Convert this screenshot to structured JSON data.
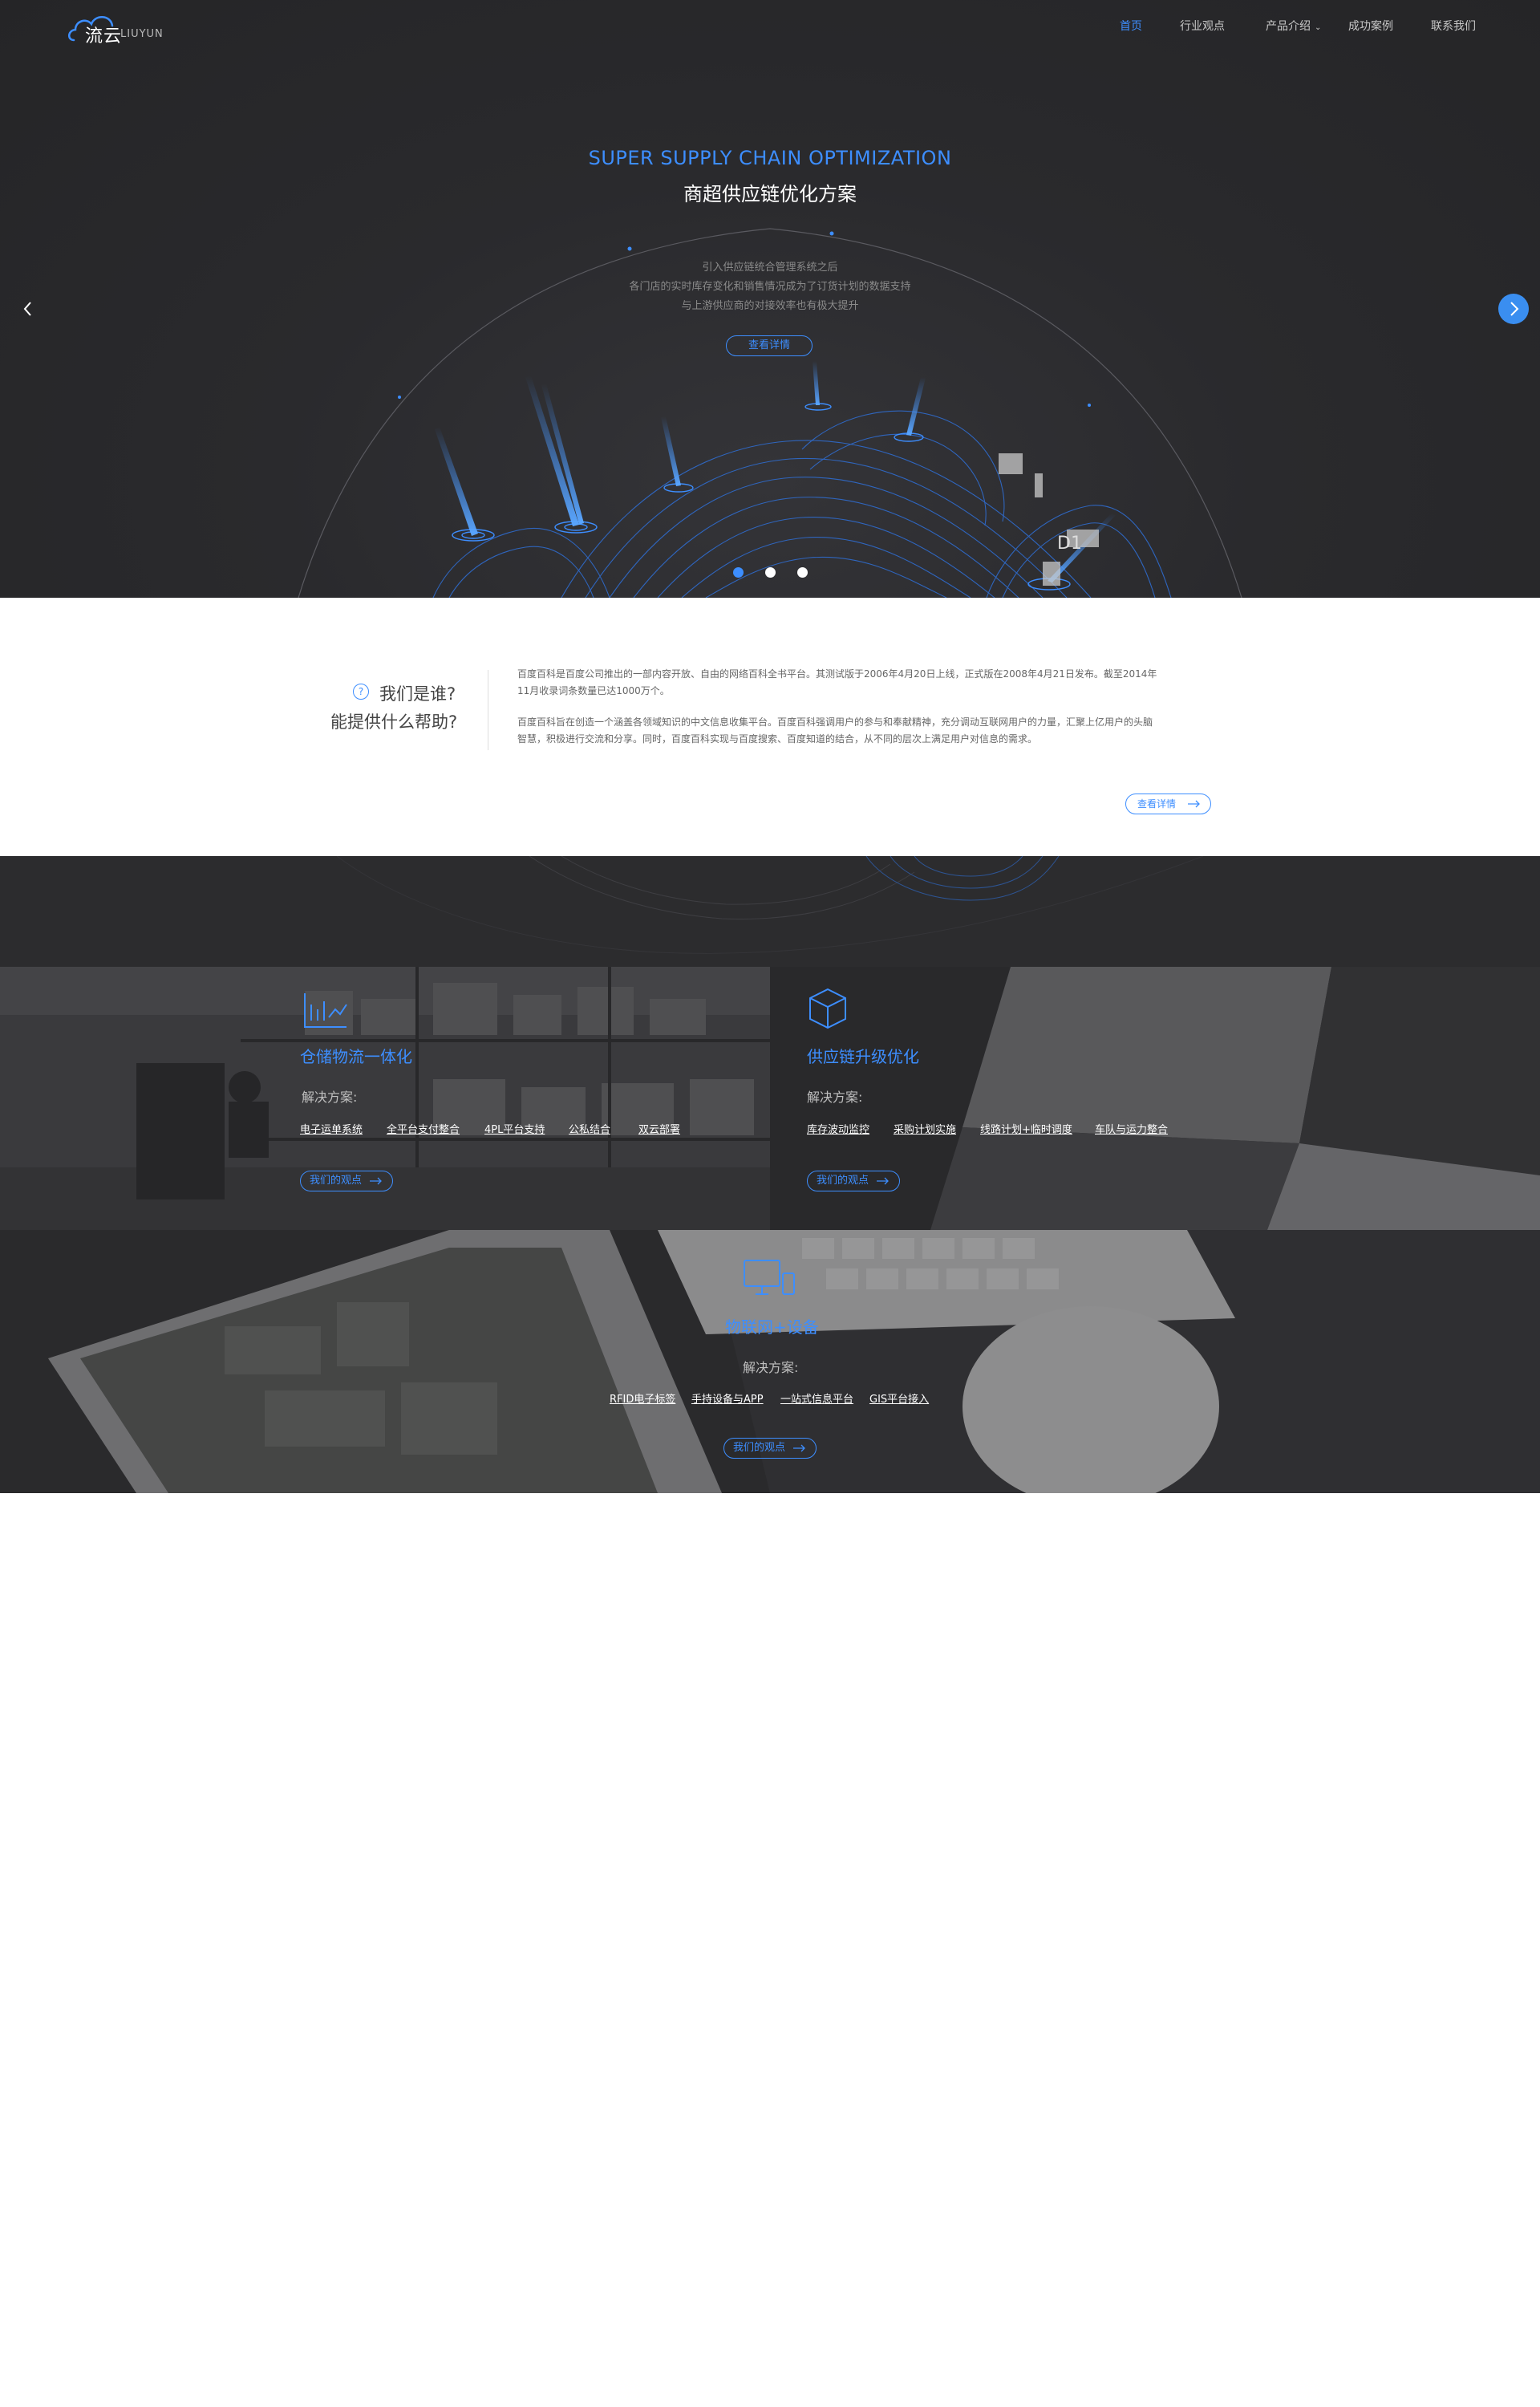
{
  "brand": {
    "name_cn": "流云",
    "name_en": "LIUYUN"
  },
  "nav": {
    "items": [
      {
        "label": "首页"
      },
      {
        "label": "行业观点"
      },
      {
        "label": "产品介绍"
      },
      {
        "label": "成功案例"
      },
      {
        "label": "联系我们"
      }
    ]
  },
  "hero": {
    "title_en": "SUPER SUPPLY CHAIN OPTIMIZATION",
    "title_cn": "商超供应链优化方案",
    "desc": [
      "引入供应链统合管理系统之后",
      "各门店的实时库存变化和销售情况成为了订货计划的数据支持",
      "与上游供应商的对接效率也有极大提升"
    ],
    "button": "查看详情",
    "mark": "D1",
    "slides": 3,
    "active_slide": 1
  },
  "about": {
    "title_line1": "我们是谁?",
    "title_line2": "能提供什么帮助?",
    "para1_line1": "百度百科是百度公司推出的一部内容开放、自由的网络百科全书平台。其测试版于2006年4月20日上线，正式版在2008年4月21日发布。截至2014年",
    "para1_line2": "11月收录词条数量已达1000万个。",
    "para2_line1": "百度百科旨在创造一个涵盖各领域知识的中文信息收集平台。百度百科强调用户的参与和奉献精神，充分调动互联网用户的力量，汇聚上亿用户的头脑",
    "para2_line2": "智慧，积极进行交流和分享。同时，百度百科实现与百度搜索、百度知道的结合，从不同的层次上满足用户对信息的需求。",
    "button": "查看详情"
  },
  "solutions": {
    "subtitle": "解决方案:",
    "button": "我们的观点",
    "warehouse": {
      "title": "仓储物流一体化",
      "links": [
        "电子运单系统",
        "全平台支付整合",
        "4PL平台支持",
        "公私结合",
        "双云部署"
      ]
    },
    "supply": {
      "title": "供应链升级优化",
      "links": [
        "库存波动监控",
        "采购计划实施",
        "线路计划+临时调度",
        "车队与运力整合"
      ]
    },
    "iot": {
      "title": "物联网+设备",
      "links": [
        "RFID电子标签",
        "手持设备与APP",
        "一站式信息平台",
        "GIS平台接入"
      ]
    }
  },
  "colors": {
    "accent": "#3d8eff",
    "dark": "#2a2a2d"
  },
  "icons": [
    "cloud-logo-icon",
    "chevron-left-icon",
    "chevron-right-icon",
    "question-icon",
    "arrow-right-icon",
    "warehouse-chart-icon",
    "cube-icon",
    "devices-icon"
  ]
}
